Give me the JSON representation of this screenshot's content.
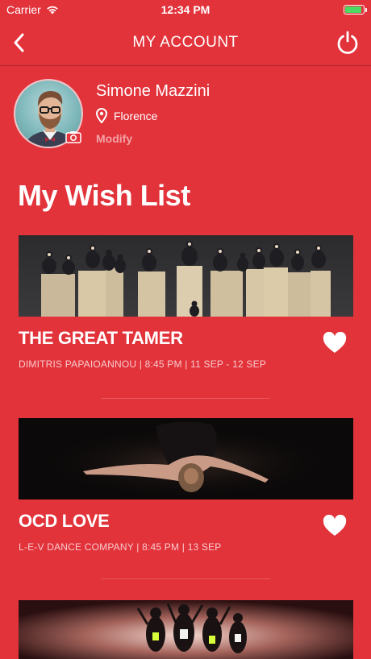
{
  "status_bar": {
    "carrier": "Carrier",
    "time": "12:34 PM",
    "battery_level": 0.9
  },
  "nav": {
    "title": "MY ACCOUNT",
    "back_icon": "chevron-left-icon",
    "power_icon": "power-icon"
  },
  "profile": {
    "name": "Simone Mazzini",
    "location": "Florence",
    "modify_label": "Modify"
  },
  "wishlist": {
    "title": "My Wish List",
    "items": [
      {
        "title": "THE GREAT TAMER",
        "meta": "DIMITRIS PAPAIOANNOU |  8:45 PM  |  11 SEP - 12  SEP",
        "favorited": true
      },
      {
        "title": "OCD LOVE",
        "meta": "L-E-V DANCE COMPANY |  8:45 PM  |  13 SEP",
        "favorited": true
      }
    ]
  },
  "colors": {
    "background": "#e2323a",
    "text": "#ffffff",
    "battery": "#4cd964"
  }
}
